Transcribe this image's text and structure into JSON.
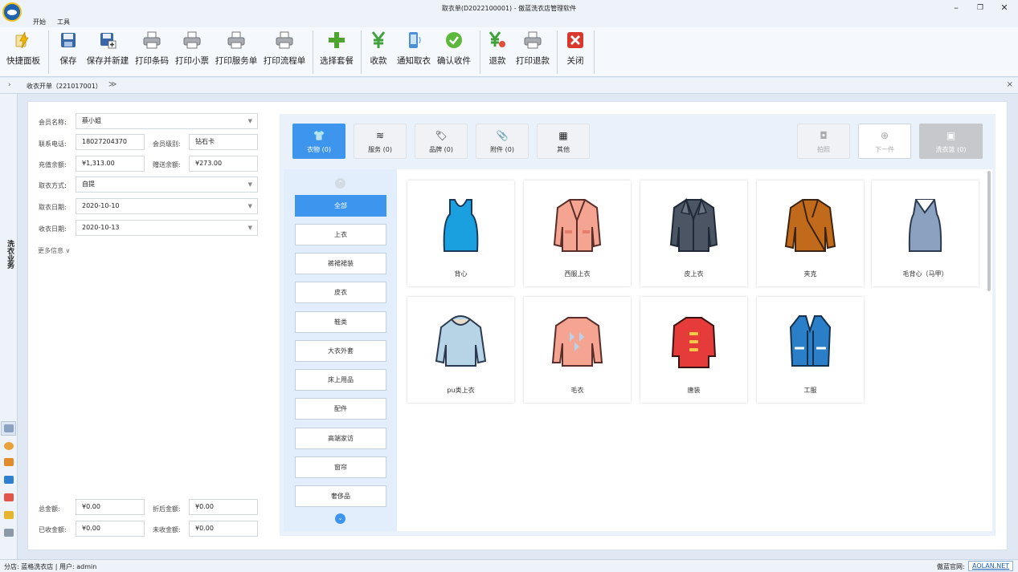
{
  "window": {
    "title": "取衣单(D2022100001) - 傲蓝洗衣店管理软件",
    "min_glyph": "–",
    "max_glyph": "❐",
    "close_glyph": "✕"
  },
  "menu": {
    "tabs": [
      "开始",
      "工具"
    ]
  },
  "ribbon": {
    "buttons": [
      {
        "label": "快捷面板",
        "icon": "lightning-icon"
      },
      {
        "label": "保存",
        "icon": "floppy-icon"
      },
      {
        "label": "保存并新建",
        "icon": "floppy-add-icon"
      },
      {
        "label": "打印条码",
        "icon": "printer-icon"
      },
      {
        "label": "打印小票",
        "icon": "printer-icon"
      },
      {
        "label": "打印服务单",
        "icon": "printer-icon"
      },
      {
        "label": "打印流程单",
        "icon": "printer-icon"
      },
      {
        "label": "选择套餐",
        "icon": "plus-icon"
      },
      {
        "label": "收款",
        "icon": "yuan-icon"
      },
      {
        "label": "通知取衣",
        "icon": "phone-icon"
      },
      {
        "label": "确认收件",
        "icon": "check-icon"
      },
      {
        "label": "退款",
        "icon": "refund-icon"
      },
      {
        "label": "打印退款",
        "icon": "printer-icon"
      },
      {
        "label": "关闭",
        "icon": "close-icon"
      }
    ]
  },
  "doc_tab": {
    "label": "收衣开单（221017001）",
    "more": "≫",
    "close": "×",
    "expand": "›"
  },
  "sidebar": {
    "label": "洗衣业务"
  },
  "form": {
    "member_name_label": "会员名称:",
    "member_name": "蔡小姐",
    "phone_label": "联系电话:",
    "phone": "18027204370",
    "level_label": "会员级别:",
    "level": "钻石卡",
    "balance_label": "充值余额:",
    "balance": "¥1,313.00",
    "gift_balance_label": "赠送余额:",
    "gift_balance": "¥273.00",
    "pickup_method_label": "取衣方式:",
    "pickup_method": "自提",
    "pickup_date_label": "取衣日期:",
    "pickup_date": "2020-10-10",
    "receive_date_label": "收衣日期:",
    "receive_date": "2020-10-13",
    "more_info": "更多信息 ∨",
    "total_label": "总金额:",
    "total": "¥0.00",
    "discounted_label": "折后金额:",
    "discounted": "¥0.00",
    "received_label": "已收金额:",
    "received": "¥0.00",
    "unreceived_label": "未收金额:",
    "unreceived": "¥0.00"
  },
  "top_tabs": [
    {
      "label": "衣物 (0)",
      "icon": "shirt-icon",
      "glyph": "👕"
    },
    {
      "label": "服务 (0)",
      "icon": "layers-icon",
      "glyph": "≋"
    },
    {
      "label": "品牌 (0)",
      "icon": "tag-icon",
      "glyph": "🏷"
    },
    {
      "label": "附件 (0)",
      "icon": "paperclip-icon",
      "glyph": "📎"
    },
    {
      "label": "其他",
      "icon": "grid-icon",
      "glyph": "▦"
    }
  ],
  "right_tabs": [
    {
      "label": "拍照",
      "icon": "camera-icon",
      "glyph": "◘"
    },
    {
      "label": "下一件",
      "icon": "plus-circle-icon",
      "glyph": "⊕"
    },
    {
      "label": "洗衣篮 (0)",
      "icon": "basket-icon",
      "glyph": "▣"
    }
  ],
  "categories": [
    "全部",
    "上衣",
    "裤裙裙装",
    "皮衣",
    "鞋类",
    "大衣外套",
    "床上用品",
    "配件",
    "高端家访",
    "窗帘",
    "奢侈品"
  ],
  "scroll_up": "⌃",
  "scroll_down": "⌄",
  "items": [
    {
      "label": "背心",
      "icon": "tank-top-icon"
    },
    {
      "label": "西服上衣",
      "icon": "suit-jacket-icon"
    },
    {
      "label": "皮上衣",
      "icon": "leather-jacket-icon"
    },
    {
      "label": "夹克",
      "icon": "jacket-icon"
    },
    {
      "label": "毛背心（马甲）",
      "icon": "sweater-vest-icon"
    },
    {
      "label": "pu类上衣",
      "icon": "hoodie-icon"
    },
    {
      "label": "毛衣",
      "icon": "sweater-icon"
    },
    {
      "label": "唐装",
      "icon": "tang-suit-icon"
    },
    {
      "label": "工服",
      "icon": "work-vest-icon"
    }
  ],
  "status": {
    "left": "分店: 蓝格洗衣店  | 用户: admin",
    "right_label": "傲蓝官网:",
    "link": "AOLAN.NET"
  }
}
